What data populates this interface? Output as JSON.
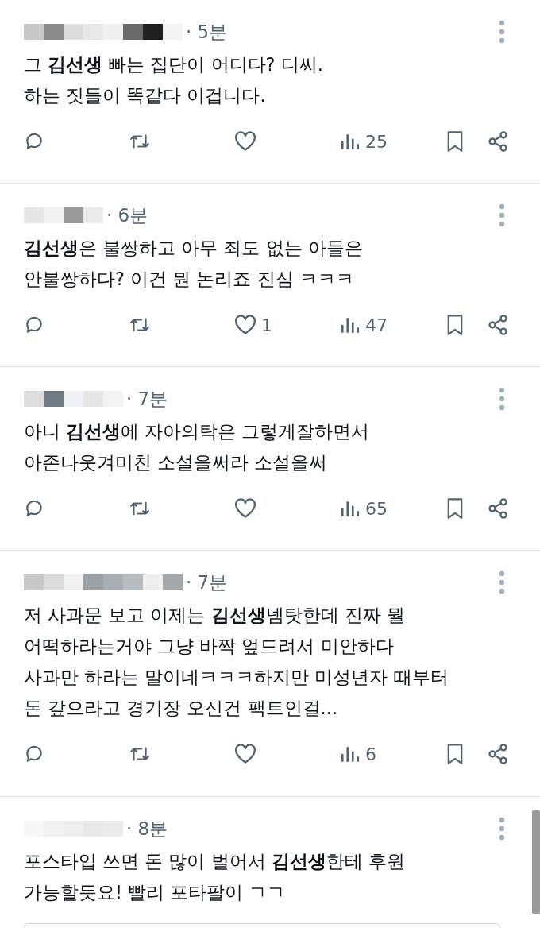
{
  "tweets": [
    {
      "time": "· 5분",
      "text": "그 **김선생** 빠는 집단이 어디다? 디씨.\n하는 짓들이 똑같다 이겁니다.",
      "views": "25"
    },
    {
      "time": "· 6분",
      "text": "**김선생**은 불쌍하고 아무 죄도 없는 아들은\n안불쌍하다? 이건 뭔 논리죠 진심 ㅋㅋㅋ",
      "likes": "1",
      "views": "47"
    },
    {
      "time": "· 7분",
      "text": "아니 **김선생**에 자아의탁은 그렇게잘하면서\n아존나웃겨미친 소설을써라 소설을써",
      "views": "65"
    },
    {
      "time": "· 7분",
      "text": "저 사과문 보고 이제는 **김선생**넴탓한데 진짜 뭘\n어떡하라는거야 그냥 바짝 엎드려서 미안하다\n사과만 하라는 말이네ㅋㅋㅋ하지만 미성년자 때부터\n돈 갚으라고 경기장 오신건 팩트인걸...",
      "views": "6"
    },
    {
      "time": "· 8분",
      "text": "포스타입 쓰면 돈 많이 벌어서 **김선생**한테 후원\n가능할듯요! 빨리 포타팔이 ㄱㄱ"
    }
  ]
}
